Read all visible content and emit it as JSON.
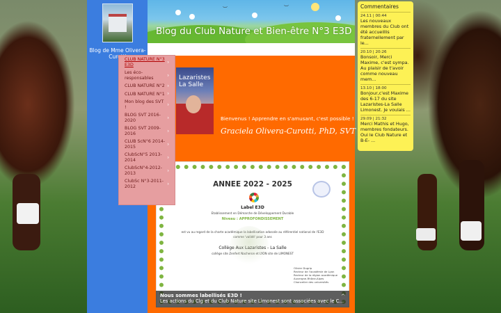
{
  "blog": {
    "title": "Blog du Club Nature et Bien-être N°3 E3D",
    "author": "Blog de Mme Olivera-Curotti"
  },
  "menu": {
    "items": [
      {
        "label": "CLUB NATURE N°3 E3D",
        "active": true
      },
      {
        "label": "Les éco-responsables"
      },
      {
        "label": "CLUB NATURE N°2"
      },
      {
        "label": "CLUB NATURE N°1"
      },
      {
        "label": "Mon blog des SVT !"
      },
      {
        "label": "BLOG SVT 2016-2020"
      },
      {
        "label": "BLOG SVT 2009-2016"
      },
      {
        "label": "CLUB ScN°6 2014-2015"
      },
      {
        "label": "ClubScN°5 2013-2014"
      },
      {
        "label": "ClubScN°4-2012-2013"
      },
      {
        "label": "ClubSc N°3-2011-2012"
      }
    ],
    "chevron": "›"
  },
  "intro": {
    "welcome": "Bienvenus ! Apprendre en s'amusant, c'est possible !",
    "signature": "Graciela Olivera-Curotti, PhD, SVT",
    "photo_text": "Lazaristes\nLa Salle"
  },
  "certificate": {
    "year": "ANNEE 2022 - 2025",
    "label": "Label E3D",
    "sub": "Etablissement en Démarche de Développement Durable",
    "level": "Niveau : APPROFONDISSEMENT",
    "line1": "est vu au regard de la charte académique la labellisation adossée au référentiel national de l'E3D",
    "line2": "comme 'validé' pour 3 ans",
    "school": "Collège Aux Lazaristes - La Salle",
    "school_sub": "collège site Zenfert Nacheron et LYON site de LIMONEST",
    "acad": "ACADÉMIE DE LYON",
    "signer": "Olivier Dugrip\nRecteur de l'académie de Lyon\nRecteur de la région académique Auvergne-Rhône-Alpes\nChancelier des universités"
  },
  "caption": {
    "title": "Nous sommes labellisés E3D !",
    "text": "Les actions du Clg et du Club Nature site Limonest sont associées avec le C...",
    "chevron": "^"
  },
  "comments": {
    "title": "Commentaires",
    "items": [
      {
        "date": "24.11 | 00:44",
        "text": "Les nouveaux membres du Club ont été accueillis fraternellement par le..."
      },
      {
        "date": "20.10 | 20:26",
        "text": "Bonsoir, Merci Maxime, c'est sympa. Au plaisir de t'avoir comme nouveau mem..."
      },
      {
        "date": "13.10 | 18:00",
        "text": "Bonjour,c'est Maxime des 6-17 du site Lazaristes-La Salle Limonest. Je voulais ..."
      },
      {
        "date": "29.09 | 21:32",
        "text": "Merci Mathis et Hugo, membres fondateurs. Oui le Club Nature et B-E- ..."
      }
    ]
  },
  "colors": {
    "left_column": "#3b7ddf",
    "content_bg": "#ff6a00",
    "menu_bg": "#e69ea0",
    "comments_bg": "#fdf155"
  }
}
